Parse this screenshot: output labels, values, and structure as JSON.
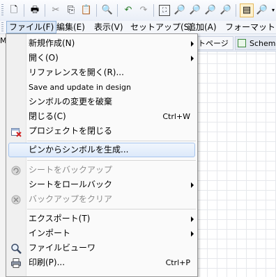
{
  "toolbar": {
    "icons": [
      "new-page-icon",
      "print-icon",
      "cut-icon",
      "copy-icon",
      "paste-icon",
      "find-icon",
      "undo-icon",
      "redo-icon",
      "zoom-fit-icon",
      "zoom-in-icon",
      "zoom-out-icon",
      "zoom-area-icon",
      "zoom-disabled-icon",
      "view-toggle-icon",
      "zoom-select-icon"
    ]
  },
  "menubar": {
    "items": [
      {
        "label": "ファイル(F)"
      },
      {
        "label": "編集(E)"
      },
      {
        "label": "表示(V)"
      },
      {
        "label": "セットアップ(S)"
      },
      {
        "label": "追加(A)"
      },
      {
        "label": "フォーマット(O)"
      }
    ]
  },
  "left_strip": {
    "label": "M"
  },
  "tabs": {
    "page": "トページ",
    "schema": "Schema"
  },
  "file_menu": {
    "items": [
      {
        "label": "新規作成(N)",
        "shortcut": "",
        "submenu": true
      },
      {
        "label": "開く(O)",
        "shortcut": "",
        "submenu": true
      },
      {
        "label": "リファレンスを開く(R)...",
        "shortcut": ""
      },
      {
        "label": "Save and update in design",
        "shortcut": ""
      },
      {
        "label": "シンボルの変更を破棄",
        "shortcut": ""
      },
      {
        "label": "閉じる(C)",
        "shortcut": "Ctrl+W"
      },
      {
        "label": "プロジェクトを閉じる",
        "shortcut": "",
        "icon": "close-project-icon"
      },
      {
        "label": "ピンからシンボルを生成...",
        "shortcut": "",
        "highlighted": true
      },
      {
        "label": "シートをバックアップ",
        "shortcut": "",
        "disabled": true,
        "icon": "backup-icon"
      },
      {
        "label": "シートをロールバック",
        "shortcut": "",
        "submenu": true
      },
      {
        "label": "バックアップをクリア",
        "shortcut": "",
        "disabled": true,
        "icon": "clear-backup-icon"
      },
      {
        "label": "エクスポート(T)",
        "shortcut": "",
        "submenu": true
      },
      {
        "label": "インポート",
        "shortcut": "",
        "submenu": true
      },
      {
        "label": "ファイルビューワ",
        "shortcut": "",
        "icon": "file-viewer-icon"
      },
      {
        "label": "印刷(P)...",
        "shortcut": "Ctrl+P",
        "icon": "print-icon"
      }
    ]
  }
}
